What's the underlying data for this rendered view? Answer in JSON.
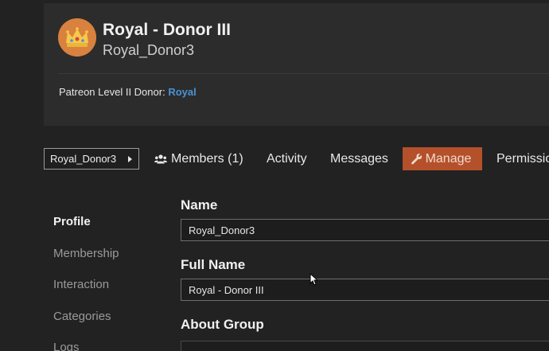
{
  "group": {
    "title": "Royal - Donor III",
    "slug": "Royal_Donor3",
    "donor_prefix": "Patreon Level II Donor: ",
    "donor_link": "Royal",
    "avatar_icon": "crown-icon"
  },
  "nav": {
    "breadcrumb": "Royal_Donor3",
    "members": "Members (1)",
    "activity": "Activity",
    "messages": "Messages",
    "manage": "Manage",
    "permissions": "Permissions"
  },
  "sidebar": {
    "items": [
      {
        "label": "Profile",
        "active": true
      },
      {
        "label": "Membership",
        "active": false
      },
      {
        "label": "Interaction",
        "active": false
      },
      {
        "label": "Categories",
        "active": false
      },
      {
        "label": "Logs",
        "active": false
      }
    ]
  },
  "form": {
    "name_label": "Name",
    "name_value": "Royal_Donor3",
    "fullname_label": "Full Name",
    "fullname_value": "Royal - Donor III",
    "about_label": "About Group"
  },
  "colors": {
    "background": "#222222",
    "card": "#2c2c2c",
    "accent": "#b4512a",
    "link": "#4a92d6",
    "avatar": "#d9813e"
  }
}
